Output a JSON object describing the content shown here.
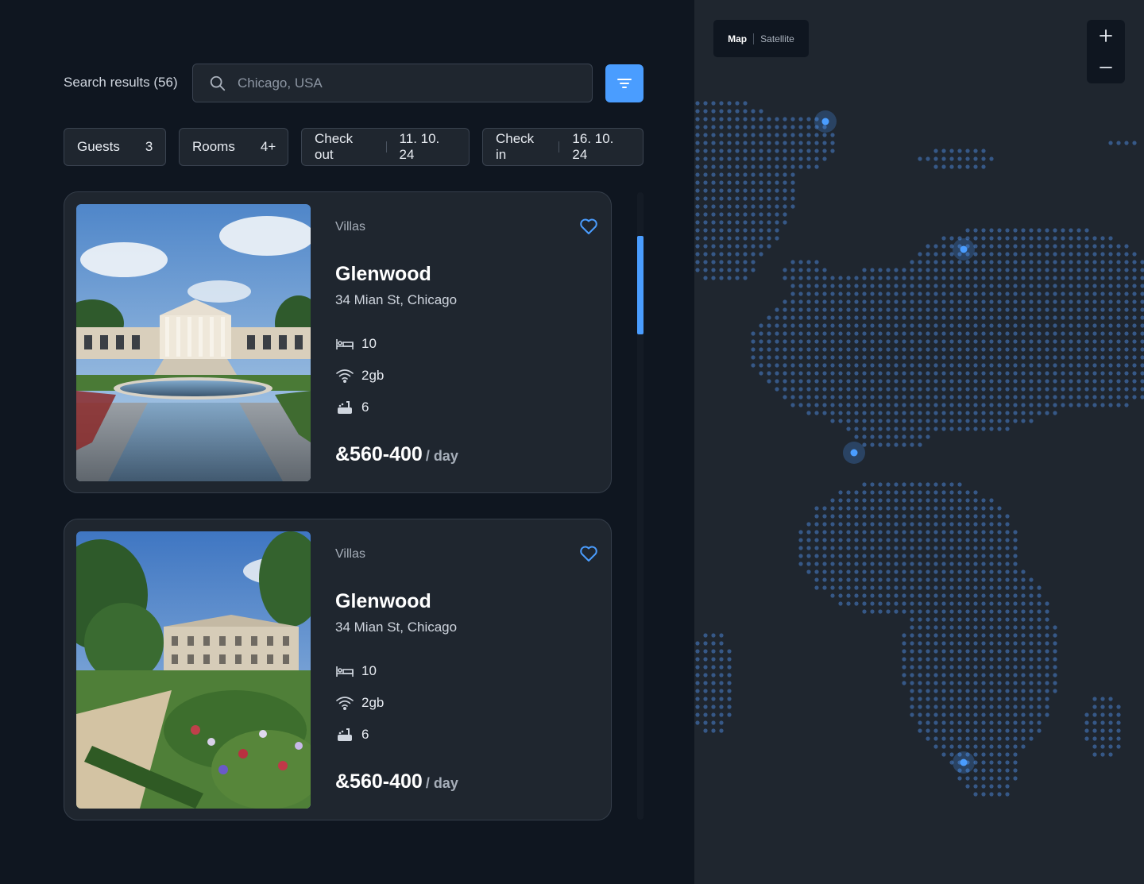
{
  "search": {
    "label": "Search results (56)",
    "placeholder": "Chicago, USA",
    "value": ""
  },
  "filters": [
    {
      "label": "Guests",
      "value": "3"
    },
    {
      "label": "Rooms",
      "value": "4+"
    },
    {
      "label": "Check out",
      "value": "11. 10. 24"
    },
    {
      "label": "Check in",
      "value": "16. 10. 24"
    }
  ],
  "listings": [
    {
      "category": "Villas",
      "name": "Glenwood",
      "address": "34 Mian St, Chicago",
      "beds": "10",
      "wifi": "2gb",
      "baths": "6",
      "price": "&560-400",
      "price_unit": "/ day"
    },
    {
      "category": "Villas",
      "name": "Glenwood",
      "address": "34 Mian St, Chicago",
      "beds": "10",
      "wifi": "2gb",
      "baths": "6",
      "price": "&560-400",
      "price_unit": "/ day"
    }
  ],
  "map": {
    "mode_map": "Map",
    "mode_satellite": "Satellite",
    "zoom_in": "+",
    "zoom_out": "−"
  },
  "colors": {
    "accent": "#4a9dff",
    "background": "#0f1620",
    "panel": "#1f262f",
    "map_dot": "#3f6aa5"
  },
  "icons": {
    "search": "search-icon",
    "filter": "filter-icon",
    "heart": "heart-icon",
    "bed": "bed-icon",
    "wifi": "wifi-icon",
    "bath": "bath-icon"
  }
}
